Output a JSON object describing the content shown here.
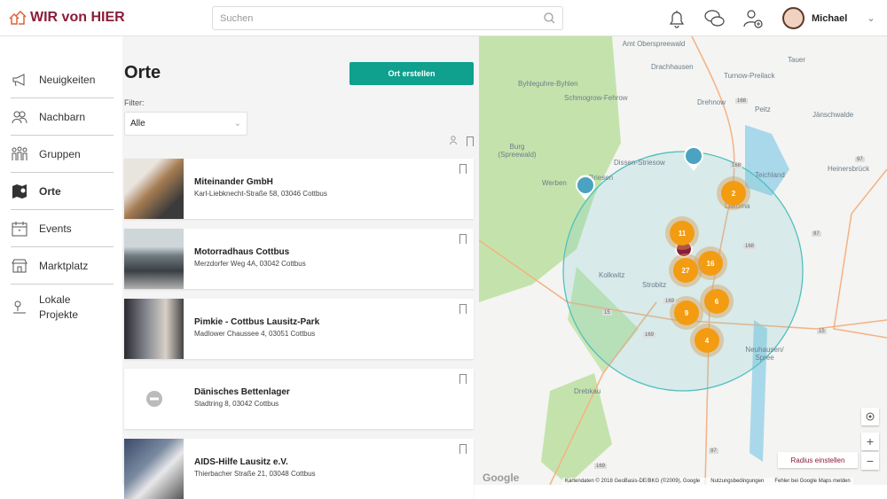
{
  "header": {
    "logo": "WIR von HIER",
    "search_placeholder": "Suchen",
    "user_name": "Michael"
  },
  "sidebar": {
    "items": [
      {
        "label": "Neuigkeiten",
        "icon": "megaphone-icon"
      },
      {
        "label": "Nachbarn",
        "icon": "people-icon"
      },
      {
        "label": "Gruppen",
        "icon": "group-icon"
      },
      {
        "label": "Orte",
        "icon": "map-icon",
        "active": true
      },
      {
        "label": "Events",
        "icon": "calendar-icon"
      },
      {
        "label": "Marktplatz",
        "icon": "market-icon"
      },
      {
        "label": "Lokale Projekte",
        "icon": "project-icon"
      }
    ]
  },
  "places": {
    "title": "Orte",
    "create_label": "Ort erstellen",
    "filter_label": "Filter:",
    "filter_value": "Alle",
    "items": [
      {
        "name": "Miteinander GmbH",
        "address": "Karl-Liebknecht-Straße 58, 03046 Cottbus",
        "thumb": "#a67c52"
      },
      {
        "name": "Motorradhaus Cottbus",
        "address": "Merzdorfer Weg 4A, 03042 Cottbus",
        "thumb": "#6f7a80"
      },
      {
        "name": "Pimkie - Cottbus Lausitz-Park",
        "address": "Madlower Chaussee 4, 03051 Cottbus",
        "thumb": "#8b8f95"
      },
      {
        "name": "Dänisches Bettenlager",
        "address": "Stadtring 8, 03042 Cottbus",
        "thumb": ""
      },
      {
        "name": "AIDS-Hilfe Lausitz e.V.",
        "address": "Thierbacher Straße 21, 03048 Cottbus",
        "thumb": "#7a8aa0"
      }
    ]
  },
  "map": {
    "labels": [
      "Amt Oberspreewald",
      "Drachhausen",
      "Tauer",
      "Byhleguhre-Byhlen",
      "Turnow-Preilack",
      "Schmogrow-Fehrow",
      "Drehnow",
      "Peitz",
      "Jänschwalde",
      "Burg (Spreewald)",
      "Dissen-Striesow",
      "Heinersbrück",
      "Werben",
      "Briesen",
      "Teichland",
      "Lakoma",
      "Strobitz",
      "Kolkwitz",
      "Neuhausen/ Spree",
      "Drebkau"
    ],
    "clusters": [
      "2",
      "11",
      "16",
      "27",
      "6",
      "9",
      "4"
    ],
    "road_labels": [
      "168",
      "168",
      "97",
      "97",
      "168",
      "169",
      "15",
      "169",
      "15",
      "97",
      "169"
    ],
    "radius_button": "Radius einstellen",
    "zoom_in": "+",
    "zoom_out": "−",
    "google": "Google",
    "attribution": [
      "Kartendaten © 2018 GeoBasis-DE/BKG (©2009), Google",
      "Nutzungsbedingungen",
      "Fehler bei Google Maps melden"
    ]
  }
}
